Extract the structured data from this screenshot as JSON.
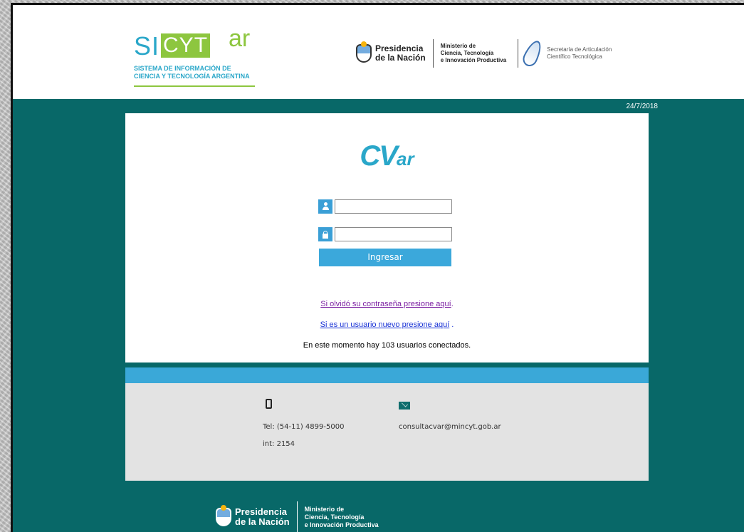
{
  "header": {
    "sicyt_prefix": "SI",
    "sicyt_box": "CYT",
    "sicyt_ar": "ar",
    "sicyt_sub_line1": "SISTEMA DE INFORMACIÓN DE",
    "sicyt_sub_line2": "CIENCIA Y TECNOLOGÍA ARGENTINA",
    "pres_line1": "Presidencia",
    "pres_line2": "de la Nación",
    "min_line1": "Ministerio de",
    "min_line2": "Ciencia, Tecnología",
    "min_line3": "e Innovación Productiva",
    "sec_line1": "Secretaría de Articulación",
    "sec_line2": "Científico Tecnológica"
  },
  "date": "24/7/2018",
  "login": {
    "logo_main": "CV",
    "logo_sub": "ar",
    "username_value": "",
    "password_value": "",
    "submit_label": "Ingresar",
    "forgot_link": "Si olvidó su contraseña presione aquí",
    "forgot_suffix": ".",
    "new_user_link": "Si es un usuario nuevo presione aquí",
    "new_user_suffix": " .",
    "online_text": "En este momento hay 103 usuarios conectados."
  },
  "contact": {
    "phone": "Tel: (54-11) 4899-5000",
    "extension": "int: 2154",
    "email": "consultacvar@mincyt.gob.ar"
  },
  "footer": {
    "pres_line1": "Presidencia",
    "pres_line2": "de la Nación",
    "min_line1": "Ministerio de",
    "min_line2": "Ciencia, Tecnología",
    "min_line3": "e Innovación Productiva"
  },
  "colors": {
    "teal_bg": "#086868",
    "accent_blue": "#3aa8d8",
    "sicyt_green": "#8dc63f"
  },
  "icons": [
    "user-icon",
    "lock-icon",
    "phone-icon",
    "mail-icon",
    "argentina-shield-icon",
    "feather-icon"
  ]
}
